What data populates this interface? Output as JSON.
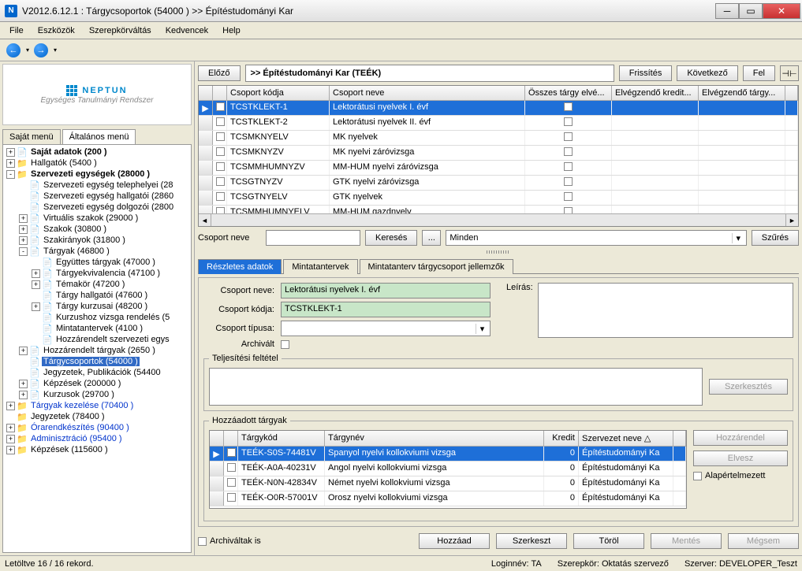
{
  "window": {
    "title": "V2012.6.12.1 : Tárgycsoportok (54000  )  >> Építéstudományi Kar"
  },
  "menu": [
    "File",
    "Eszközök",
    "Szerepkörváltás",
    "Kedvencek",
    "Help"
  ],
  "logo": {
    "main": "NEPTUN",
    "sub": "Egységes Tanulmányi Rendszer"
  },
  "leftTabs": {
    "t1": "Saját menü",
    "t2": "Általános menü"
  },
  "tree": [
    {
      "ind": 0,
      "tg": "+",
      "icon": "📄",
      "bold": true,
      "label": "Saját adatok (200  )"
    },
    {
      "ind": 0,
      "tg": "+",
      "icon": "📁",
      "label": "Hallgatók (5400  )"
    },
    {
      "ind": 0,
      "tg": "-",
      "icon": "📁",
      "bold": true,
      "label": "Szervezeti egységek (28000  )"
    },
    {
      "ind": 1,
      "tg": " ",
      "icon": "📄",
      "label": "Szervezeti egység telephelyei (28"
    },
    {
      "ind": 1,
      "tg": " ",
      "icon": "📄",
      "label": "Szervezeti egység hallgatói (2860"
    },
    {
      "ind": 1,
      "tg": " ",
      "icon": "📄",
      "label": "Szervezeti egység dolgozói (2800"
    },
    {
      "ind": 1,
      "tg": "+",
      "icon": "📄",
      "label": "Virtuális szakok (29000  )"
    },
    {
      "ind": 1,
      "tg": "+",
      "icon": "📄",
      "label": "Szakok (30800  )"
    },
    {
      "ind": 1,
      "tg": "+",
      "icon": "📄",
      "label": "Szakirányok (31800  )"
    },
    {
      "ind": 1,
      "tg": "-",
      "icon": "📄",
      "label": "Tárgyak (46800  )"
    },
    {
      "ind": 2,
      "tg": " ",
      "icon": "📄",
      "label": "Együttes tárgyak (47000  )"
    },
    {
      "ind": 2,
      "tg": "+",
      "icon": "📄",
      "label": "Tárgyekvivalencia (47100  )"
    },
    {
      "ind": 2,
      "tg": "+",
      "icon": "📄",
      "label": "Témakör (47200  )"
    },
    {
      "ind": 2,
      "tg": " ",
      "icon": "📄",
      "label": "Tárgy hallgatói (47600  )"
    },
    {
      "ind": 2,
      "tg": "+",
      "icon": "📄",
      "label": "Tárgy kurzusai (48200  )"
    },
    {
      "ind": 2,
      "tg": " ",
      "icon": "📄",
      "label": "Kurzushoz vizsga rendelés (5"
    },
    {
      "ind": 2,
      "tg": " ",
      "icon": "📄",
      "label": "Mintatantervek (4100  )"
    },
    {
      "ind": 2,
      "tg": " ",
      "icon": "📄",
      "label": "Hozzárendelt szervezeti egys"
    },
    {
      "ind": 1,
      "tg": "+",
      "icon": "📄",
      "label": "Hozzárendelt tárgyak (2650  )"
    },
    {
      "ind": 1,
      "tg": " ",
      "icon": "📄",
      "sel": true,
      "label": "Tárgycsoportok (54000  )"
    },
    {
      "ind": 1,
      "tg": " ",
      "icon": "📄",
      "label": "Jegyzetek, Publikációk (54400"
    },
    {
      "ind": 1,
      "tg": "+",
      "icon": "📄",
      "label": "Képzések (200000  )"
    },
    {
      "ind": 1,
      "tg": "+",
      "icon": "📄",
      "label": "Kurzusok (29700  )"
    },
    {
      "ind": 0,
      "tg": "+",
      "icon": "📁",
      "blue": true,
      "label": "Tárgyak kezelése (70400  )"
    },
    {
      "ind": 0,
      "tg": " ",
      "icon": "📁",
      "label": "Jegyzetek (78400  )"
    },
    {
      "ind": 0,
      "tg": "+",
      "icon": "📁",
      "blue": true,
      "label": "Órarendkészítés (90400  )"
    },
    {
      "ind": 0,
      "tg": "+",
      "icon": "📁",
      "blue": true,
      "label": "Adminisztráció (95400  )"
    },
    {
      "ind": 0,
      "tg": "+",
      "icon": "📁",
      "label": "Képzések (115600  )"
    }
  ],
  "topBar": {
    "prev": "Előző",
    "crumb": ">> Építéstudományi Kar (TEÉK)",
    "refresh": "Frissítés",
    "next": "Következő",
    "up": "Fel"
  },
  "grid1": {
    "headers": {
      "h_code": "Csoport kódja",
      "h_name": "Csoport neve",
      "h_all": "Összes tárgy elvé...",
      "h_credit": "Elvégzendő kredit...",
      "h_targ": "Elvégzendő tárgy..."
    },
    "rows": [
      {
        "sel": true,
        "code": "TCSTKLEKT-1",
        "name": "Lektorátusi nyelvek I. évf"
      },
      {
        "code": "TCSTKLEKT-2",
        "name": "Lektorátusi nyelvek II. évf"
      },
      {
        "code": "TCSMKNYELV",
        "name": "MK nyelvek"
      },
      {
        "code": "TCSMKNYZV",
        "name": "MK nyelvi záróvizsga"
      },
      {
        "code": "TCSMMHUMNYZV",
        "name": "MM-HUM nyelvi záróvizsga"
      },
      {
        "code": "TCSGTNYZV",
        "name": "GTK nyelvi záróvizsga"
      },
      {
        "code": "TCSGTNYELV",
        "name": "GTK nyelvek"
      },
      {
        "code": "TCSMMHUMNYELV",
        "name": "MM-HUM gazdnyelv"
      }
    ]
  },
  "search": {
    "label": "Csoport neve",
    "kereses": "Keresés",
    "dots": "...",
    "minden": "Minden",
    "szures": "Szűrés"
  },
  "dtabs": {
    "t1": "Részletes adatok",
    "t2": "Mintatantervek",
    "t3": "Mintatanterv tárgycsoport jellemzők"
  },
  "detail": {
    "l_name": "Csoport neve:",
    "v_name": "Lektorátusi nyelvek I. évf",
    "l_code": "Csoport kódja:",
    "v_code": "TCSTKLEKT-1",
    "l_type": "Csoport típusa:",
    "l_arch": "Archivált",
    "l_desc": "Leírás:",
    "fs1": "Teljesítési feltétel",
    "edit": "Szerkesztés",
    "fs2": "Hozzáadott tárgyak"
  },
  "grid2": {
    "headers": {
      "h_code": "Tárgykód",
      "h_name": "Tárgynév",
      "h_kr": "Kredit",
      "h_org": "Szervezet neve  △"
    },
    "rows": [
      {
        "sel": true,
        "code": "TEÉK-S0S-74481V",
        "name": "Spanyol nyelvi kollokviumi vizsga",
        "kr": "0",
        "org": "Építéstudományi Ka"
      },
      {
        "code": "TEÉK-A0A-40231V",
        "name": "Angol nyelvi kollokviumi vizsga",
        "kr": "0",
        "org": "Építéstudományi Ka"
      },
      {
        "code": "TEÉK-N0N-42834V",
        "name": "Német nyelvi kollokviumi vizsga",
        "kr": "0",
        "org": "Építéstudományi Ka"
      },
      {
        "code": "TEÉK-O0R-57001V",
        "name": "Orosz nyelvi kollokviumi vizsga",
        "kr": "0",
        "org": "Építéstudományi Ka"
      }
    ]
  },
  "sideBtns": {
    "assign": "Hozzárendel",
    "remove": "Elvesz",
    "default": "Alapértelmezett"
  },
  "bottom": {
    "arch": "Archiváltak is",
    "add": "Hozzáad",
    "edit": "Szerkeszt",
    "del": "Töröl",
    "save": "Mentés",
    "cancel": "Mégsem"
  },
  "status": {
    "rec": "Letöltve 16 / 16 rekord.",
    "login": "Loginnév: TA",
    "role": "Szerepkör: Oktatás szervező",
    "server": "Szerver: DEVELOPER_Teszt"
  }
}
